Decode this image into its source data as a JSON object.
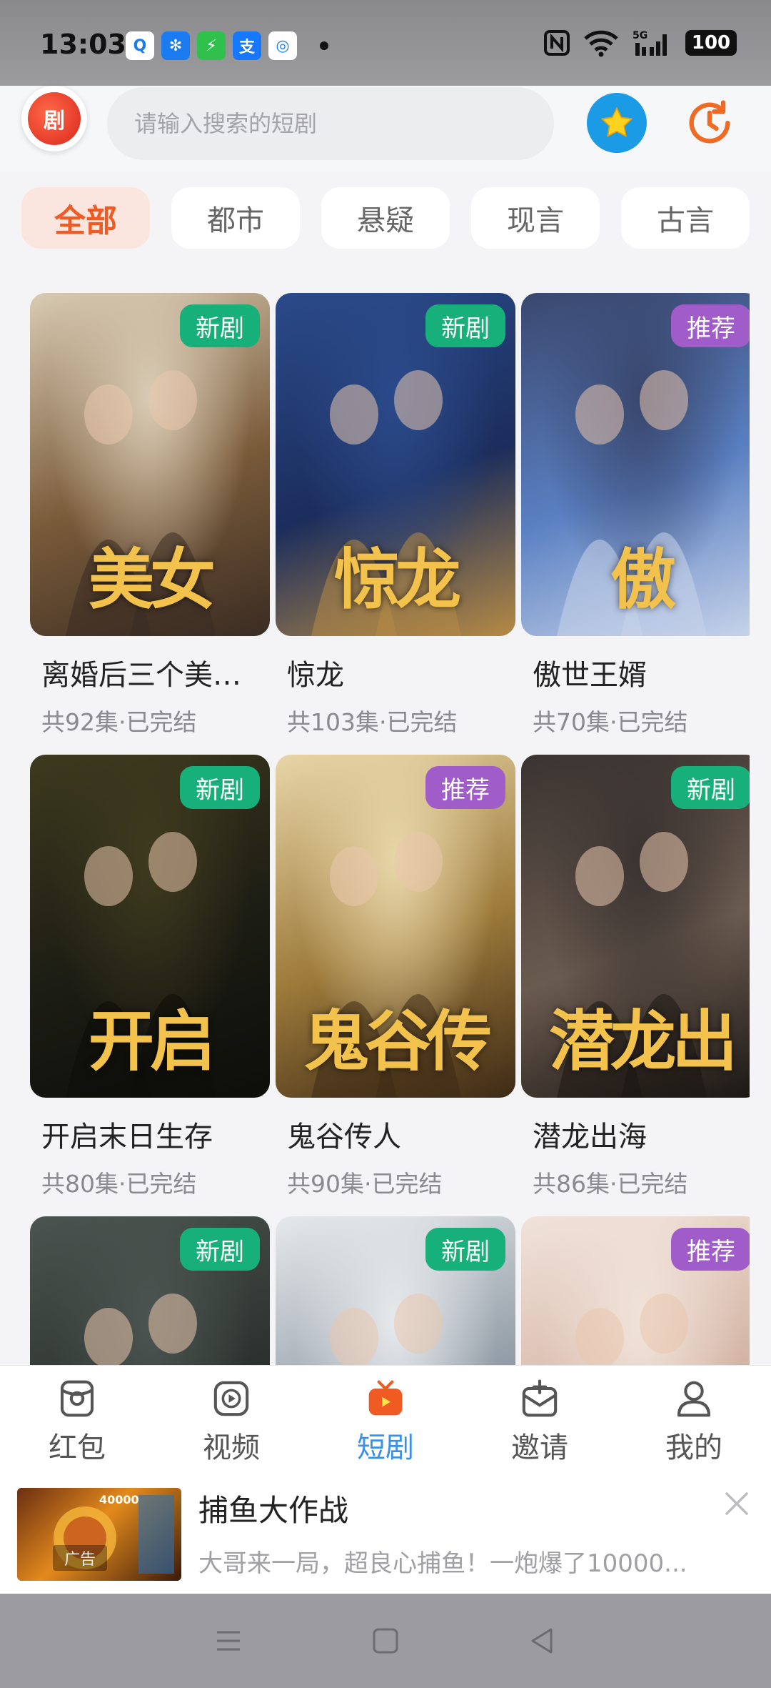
{
  "status_bar": {
    "time": "13:03",
    "apps": [
      {
        "icon": "qq-icon",
        "glyph": "Q",
        "color": "#ffffff"
      },
      {
        "icon": "pinwheel-icon",
        "glyph": "✻",
        "color": "#1a7cf0"
      },
      {
        "icon": "shield-icon",
        "glyph": "⚡",
        "color": "#2fc14b"
      },
      {
        "icon": "alipay-icon",
        "glyph": "支",
        "color": "#1677ff"
      },
      {
        "icon": "china-mobile-icon",
        "glyph": "◎",
        "color": "#ffffff"
      }
    ],
    "network_label": "5G",
    "battery": "100"
  },
  "header": {
    "logo_text": "剧",
    "search_placeholder": "请输入搜索的短剧"
  },
  "tabs": [
    {
      "label": "全部",
      "active": true
    },
    {
      "label": "都市",
      "active": false
    },
    {
      "label": "悬疑",
      "active": false
    },
    {
      "label": "现言",
      "active": false
    },
    {
      "label": "古言",
      "active": false
    }
  ],
  "dramas": [
    {
      "title": "离婚后三个美女缠上我",
      "meta": "共92集·已完结",
      "badge": "新剧",
      "badge_type": "new",
      "poster_text": "美女",
      "colors": [
        "#d9cbb4",
        "#7a5b3a",
        "#3a2c22"
      ]
    },
    {
      "title": "惊龙",
      "meta": "共103集·已完结",
      "badge": "新剧",
      "badge_type": "new",
      "poster_text": "惊龙",
      "colors": [
        "#2b4a8a",
        "#1b2d5c",
        "#b58a45"
      ]
    },
    {
      "title": "傲世王婿",
      "meta": "共70集·已完结",
      "badge": "推荐",
      "badge_type": "rec",
      "poster_text": "傲",
      "colors": [
        "#39476e",
        "#5a80c2",
        "#c8d4ea"
      ]
    },
    {
      "title": "开启末日生存",
      "meta": "共80集·已完结",
      "badge": "新剧",
      "badge_type": "new",
      "poster_text": "开启",
      "colors": [
        "#3e3a1e",
        "#1c1d14",
        "#0d0d0a"
      ]
    },
    {
      "title": "鬼谷传人",
      "meta": "共90集·已完结",
      "badge": "推荐",
      "badge_type": "rec",
      "poster_text": "鬼谷传",
      "colors": [
        "#e8d6a8",
        "#9c7a3a",
        "#3e2a16"
      ]
    },
    {
      "title": "潜龙出海",
      "meta": "共86集·已完结",
      "badge": "新剧",
      "badge_type": "new",
      "poster_text": "潜龙出",
      "colors": [
        "#3a3330",
        "#6a5b50",
        "#1b1613"
      ]
    },
    {
      "title": "",
      "meta": "",
      "badge": "新剧",
      "badge_type": "new",
      "poster_text": "",
      "colors": [
        "#4b5450",
        "#2a302d",
        "#1a1d1b"
      ]
    },
    {
      "title": "",
      "meta": "",
      "badge": "新剧",
      "badge_type": "new",
      "poster_text": "",
      "colors": [
        "#e6e9ec",
        "#8f9aa4",
        "#2a2f35"
      ]
    },
    {
      "title": "",
      "meta": "",
      "badge": "推荐",
      "badge_type": "rec",
      "poster_text": "",
      "colors": [
        "#f1e3da",
        "#d2b2a2",
        "#7a5a4a"
      ]
    }
  ],
  "bottom_nav": [
    {
      "label": "红包",
      "icon": "red-packet-icon",
      "active": false
    },
    {
      "label": "视频",
      "icon": "video-icon",
      "active": false
    },
    {
      "label": "短剧",
      "icon": "short-drama-icon",
      "active": true
    },
    {
      "label": "邀请",
      "icon": "invite-icon",
      "active": false
    },
    {
      "label": "我的",
      "icon": "profile-icon",
      "active": false
    }
  ],
  "ad": {
    "title": "捕鱼大作战",
    "description": "大哥来一局，超良心捕鱼！一炮爆了10000...",
    "label": "广告",
    "thumb_number": "40000"
  }
}
